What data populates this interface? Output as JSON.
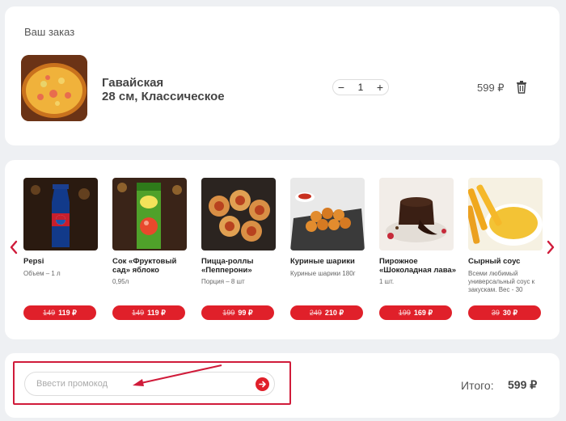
{
  "order": {
    "title": "Ваш заказ",
    "item": {
      "name": "Гавайская",
      "description": "28 см, Классическое",
      "quantity": "1",
      "minus": "−",
      "plus": "+",
      "price": "599 ₽"
    }
  },
  "upsell": {
    "products": [
      {
        "name": "Pepsi",
        "subtitle": "Объем – 1 л",
        "old_price": "149",
        "new_price": "119 ₽"
      },
      {
        "name": "Сок «Фруктовый сад» яблоко",
        "subtitle": "0,95л",
        "old_price": "149",
        "new_price": "119 ₽"
      },
      {
        "name": "Пицца-роллы «Пепперони»",
        "subtitle": "Порция – 8 шт",
        "old_price": "199",
        "new_price": "99 ₽"
      },
      {
        "name": "Куриные шарики",
        "subtitle": "Куриные шарики 180г",
        "old_price": "249",
        "new_price": "210 ₽"
      },
      {
        "name": "Пирожное «Шоколадная лава»",
        "subtitle": "1 шт.",
        "old_price": "199",
        "new_price": "169 ₽"
      },
      {
        "name": "Сырный соус",
        "subtitle": "Всеми любимый универсальный соус к закускам. Вес - 30",
        "old_price": "39",
        "new_price": "30 ₽"
      }
    ]
  },
  "promo": {
    "placeholder": "Ввести промокод"
  },
  "total": {
    "label": "Итого:",
    "value": "599 ₽"
  },
  "colors": {
    "accent": "#e0202a",
    "highlight": "#d01b3a",
    "background": "#eef0f3"
  }
}
